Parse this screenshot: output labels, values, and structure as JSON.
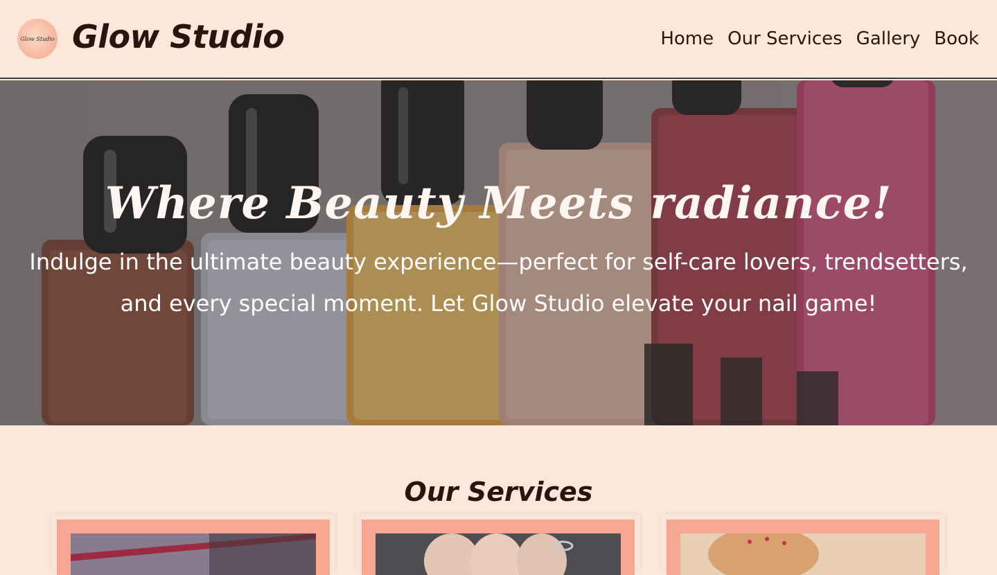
{
  "header": {
    "logo_text": "Glow Studio",
    "brand": "Glow Studio",
    "nav": [
      {
        "label": "Home"
      },
      {
        "label": "Our Services"
      },
      {
        "label": "Gallery"
      },
      {
        "label": "Book"
      }
    ]
  },
  "hero": {
    "title": "Where Beauty Meets radiance!",
    "subtitle": "Indulge in the ultimate beauty experience—perfect for self-care lovers, trendsetters, and every special moment. Let Glow Studio elevate your nail game!"
  },
  "services": {
    "title": "Our Services",
    "cards": [
      {
        "image": "nail-service-photo-1"
      },
      {
        "image": "nail-service-photo-2"
      },
      {
        "image": "nail-service-photo-3"
      }
    ]
  },
  "colors": {
    "background": "#fce8da",
    "text": "#2a150c",
    "card_frame": "#f8a793",
    "hero_text": "#ffffff"
  }
}
